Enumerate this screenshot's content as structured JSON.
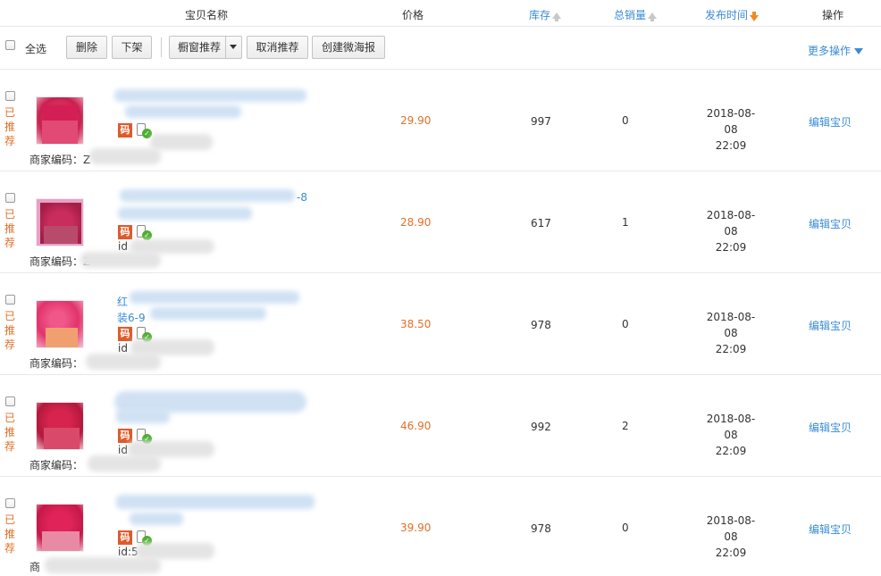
{
  "header": {
    "name": "宝贝名称",
    "price": "价格",
    "stock": "库存",
    "sales": "总销量",
    "publish": "发布时间",
    "ops": "操作"
  },
  "toolbar": {
    "select_all": "全选",
    "delete": "删除",
    "unlist": "下架",
    "window_recommend": "橱窗推荐",
    "cancel_recommend": "取消推荐",
    "create_poster": "创建微海报",
    "more_ops": "更多操作"
  },
  "rows": [
    {
      "status": "已推荐",
      "title_frag": "",
      "title_frag2": "",
      "badge": "码",
      "id_text": "",
      "code_label": "商家编码：Z",
      "price": "29.90",
      "stock": "997",
      "sales": "0",
      "date": "2018-08-08",
      "time": "22:09",
      "edit": "编辑宝贝"
    },
    {
      "status": "已推荐",
      "title_frag": "-8",
      "title_frag2": "",
      "badge": "码",
      "id_text": "id",
      "code_label": "商家编码：Z",
      "price": "28.90",
      "stock": "617",
      "sales": "1",
      "date": "2018-08-08",
      "time": "22:09",
      "edit": "编辑宝贝"
    },
    {
      "status": "已推荐",
      "title_frag": "红",
      "title_frag2": "装6-9",
      "badge": "码",
      "id_text": "id",
      "code_label": "商家编码：",
      "price": "38.50",
      "stock": "978",
      "sales": "0",
      "date": "2018-08-08",
      "time": "22:09",
      "edit": "编辑宝贝"
    },
    {
      "status": "已推荐",
      "title_frag": "",
      "title_frag2": "",
      "badge": "码",
      "id_text": "id",
      "code_label": "商家编码：",
      "price": "46.90",
      "stock": "992",
      "sales": "2",
      "date": "2018-08-08",
      "time": "22:09",
      "edit": "编辑宝贝"
    },
    {
      "status": "已推荐",
      "title_frag": "",
      "title_frag2": "",
      "badge": "码",
      "id_text": "id:5",
      "code_label": "商",
      "price": "39.90",
      "stock": "978",
      "sales": "0",
      "date": "2018-08-08",
      "time": "22:09",
      "edit": "编辑宝贝"
    }
  ]
}
